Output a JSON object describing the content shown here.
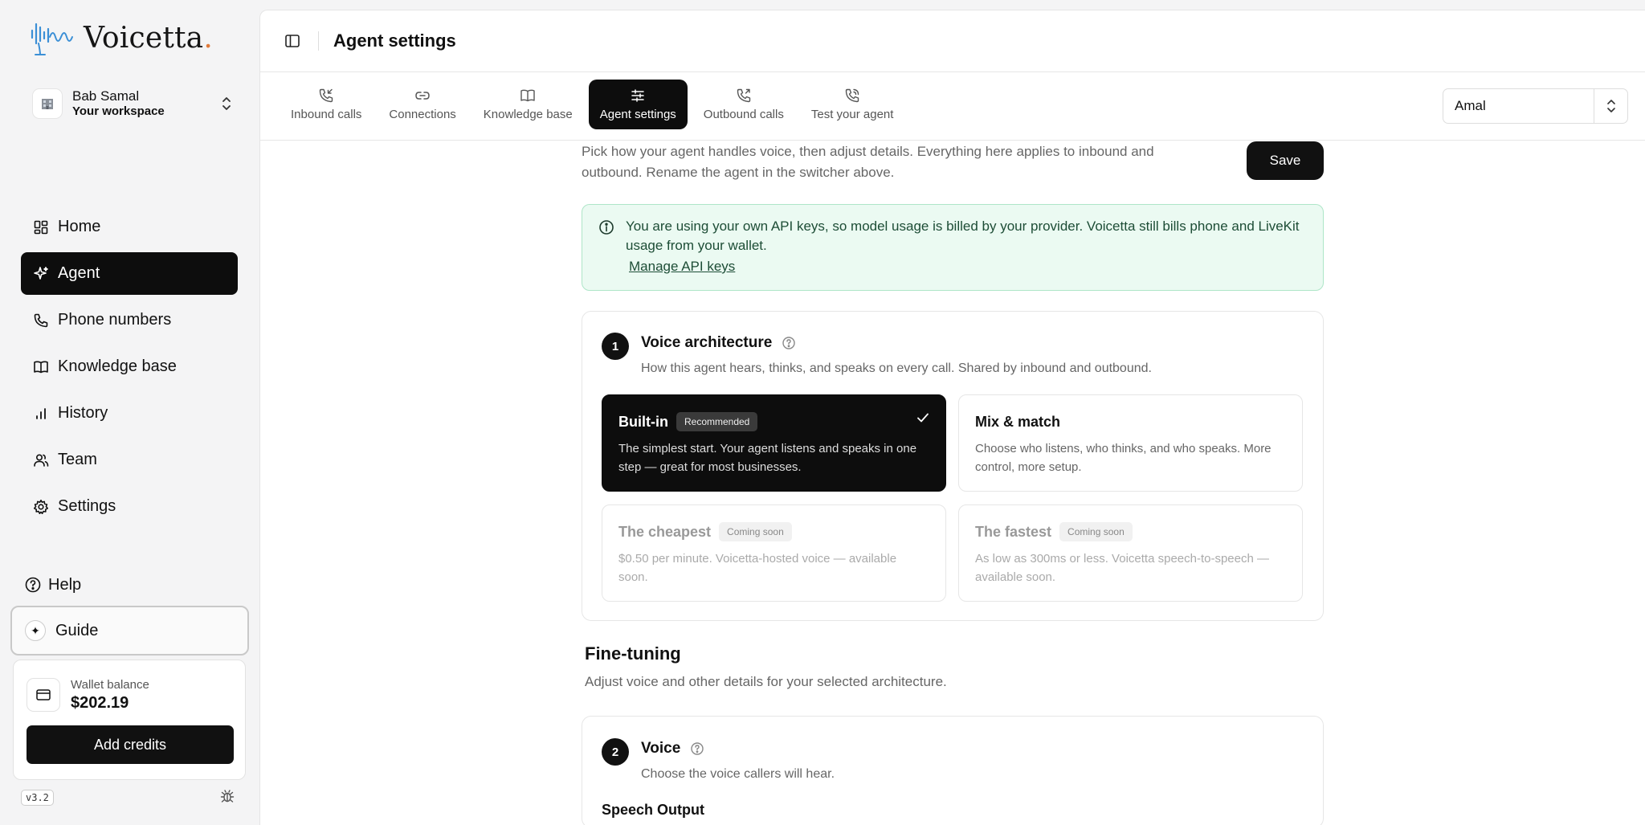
{
  "brand": {
    "name": "Voicetta",
    "dot": "."
  },
  "workspace": {
    "name": "Bab Samal",
    "subtitle": "Your workspace"
  },
  "nav": {
    "items": [
      {
        "label": "Home",
        "icon": "grid-icon",
        "active": false
      },
      {
        "label": "Agent",
        "icon": "sparkle-icon",
        "active": true
      },
      {
        "label": "Phone numbers",
        "icon": "phone-icon",
        "active": false
      },
      {
        "label": "Knowledge base",
        "icon": "book-icon",
        "active": false
      },
      {
        "label": "History",
        "icon": "bar-chart-icon",
        "active": false
      },
      {
        "label": "Team",
        "icon": "users-icon",
        "active": false
      },
      {
        "label": "Settings",
        "icon": "gear-icon",
        "active": false
      }
    ],
    "help": "Help",
    "guide": "Guide"
  },
  "wallet": {
    "label": "Wallet balance",
    "value": "$202.19",
    "button": "Add credits"
  },
  "version": "v3.2",
  "header": {
    "title": "Agent settings"
  },
  "tabs": [
    {
      "label": "Inbound calls",
      "icon": "phone-incoming-icon"
    },
    {
      "label": "Connections",
      "icon": "link-icon"
    },
    {
      "label": "Knowledge base",
      "icon": "book-icon"
    },
    {
      "label": "Agent settings",
      "icon": "sliders-icon"
    },
    {
      "label": "Outbound calls",
      "icon": "phone-outgoing-icon"
    },
    {
      "label": "Test your agent",
      "icon": "phone-call-icon"
    }
  ],
  "agent_select": {
    "value": "Amal"
  },
  "intro": {
    "text": "Pick how your agent handles voice, then adjust details. Everything here applies to inbound and outbound. Rename the agent in the switcher above.",
    "save": "Save"
  },
  "notice": {
    "text": "You are using your own API keys, so model usage is billed by your provider. Voicetta still bills phone and LiveKit usage from your wallet.",
    "link": "Manage API keys"
  },
  "architecture": {
    "step": "1",
    "title": "Voice architecture",
    "subtitle": "How this agent hears, thinks, and speaks on every call. Shared by inbound and outbound.",
    "options": [
      {
        "title": "Built-in",
        "badge": "Recommended",
        "desc": "The simplest start. Your agent listens and speaks in one step — great for most businesses."
      },
      {
        "title": "Mix & match",
        "badge": "",
        "desc": "Choose who listens, who thinks, and who speaks. More control, more setup."
      },
      {
        "title": "The cheapest",
        "badge": "Coming soon",
        "desc": "$0.50 per minute. Voicetta-hosted voice — available soon."
      },
      {
        "title": "The fastest",
        "badge": "Coming soon",
        "desc": "As low as 300ms or less. Voicetta speech-to-speech — available soon."
      }
    ]
  },
  "finetuning": {
    "title": "Fine-tuning",
    "subtitle": "Adjust voice and other details for your selected architecture."
  },
  "voice": {
    "step": "2",
    "title": "Voice",
    "subtitle": "Choose the voice callers will hear.",
    "next_label": "Speech Output"
  }
}
